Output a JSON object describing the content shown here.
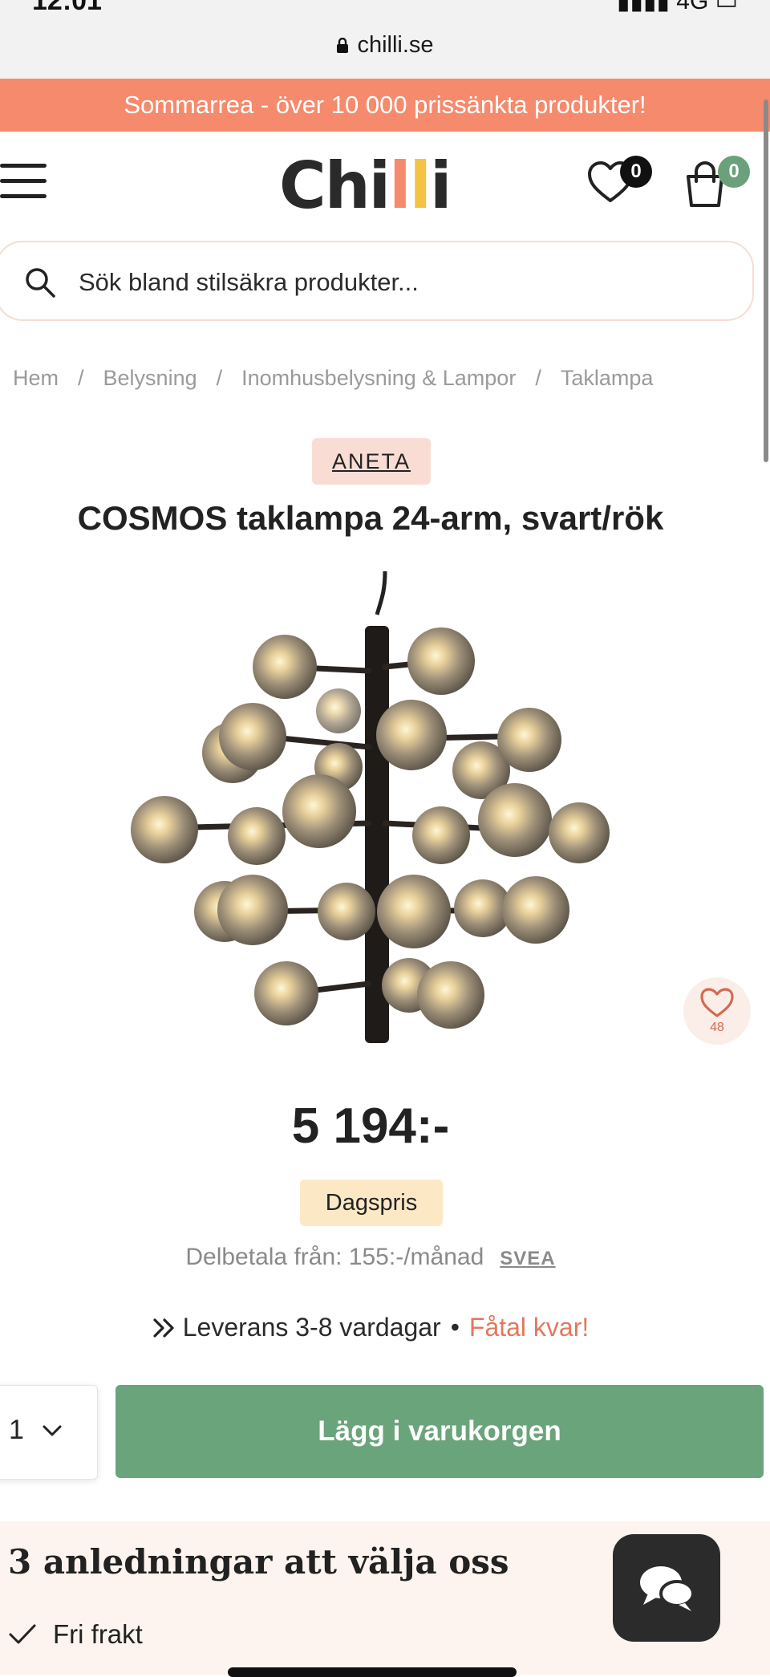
{
  "status_bar": {
    "time": "12:01",
    "signal": "4G"
  },
  "browser": {
    "url": "chilli.se"
  },
  "promo_banner": "Sommarrea - över 10 000 prissänkta produkter!",
  "header": {
    "logo_prefix": "Chi",
    "logo_l1": "l",
    "logo_l2": "l",
    "logo_suffix": "i",
    "wishlist_count": "0",
    "cart_count": "0"
  },
  "search": {
    "placeholder": "Sök bland stilsäkra produkter..."
  },
  "breadcrumb": [
    "Hem",
    "Belysning",
    "Inomhusbelysning & Lampor",
    "Taklampa"
  ],
  "product": {
    "brand": "ANETA",
    "title": "COSMOS taklampa 24-arm, svart/rök",
    "favorites_count": "48",
    "price": "5 194:-",
    "price_badge": "Dagspris",
    "installment_text": "Delbetala från: 155:-/månad",
    "installment_provider": "SVEA",
    "delivery_text": "Leverans 3-8 vardagar",
    "stock_text": "Fåtal kvar!",
    "quantity": "1",
    "add_to_cart_label": "Lägg i varukorgen"
  },
  "reasons": {
    "title": "3 anledningar att välja oss",
    "items": [
      "Fri frakt"
    ]
  },
  "colors": {
    "promo": "#f58a6d",
    "accent_green": "#6aa47b",
    "brand_tag": "#f9ddd4",
    "price_badge": "#fde8c6",
    "stock_warning": "#e2785c"
  },
  "icons": [
    "lock-icon",
    "menu-icon",
    "heart-icon",
    "bag-icon",
    "search-icon",
    "chevron-down-icon",
    "double-chevron-icon",
    "check-icon",
    "chat-icon"
  ]
}
